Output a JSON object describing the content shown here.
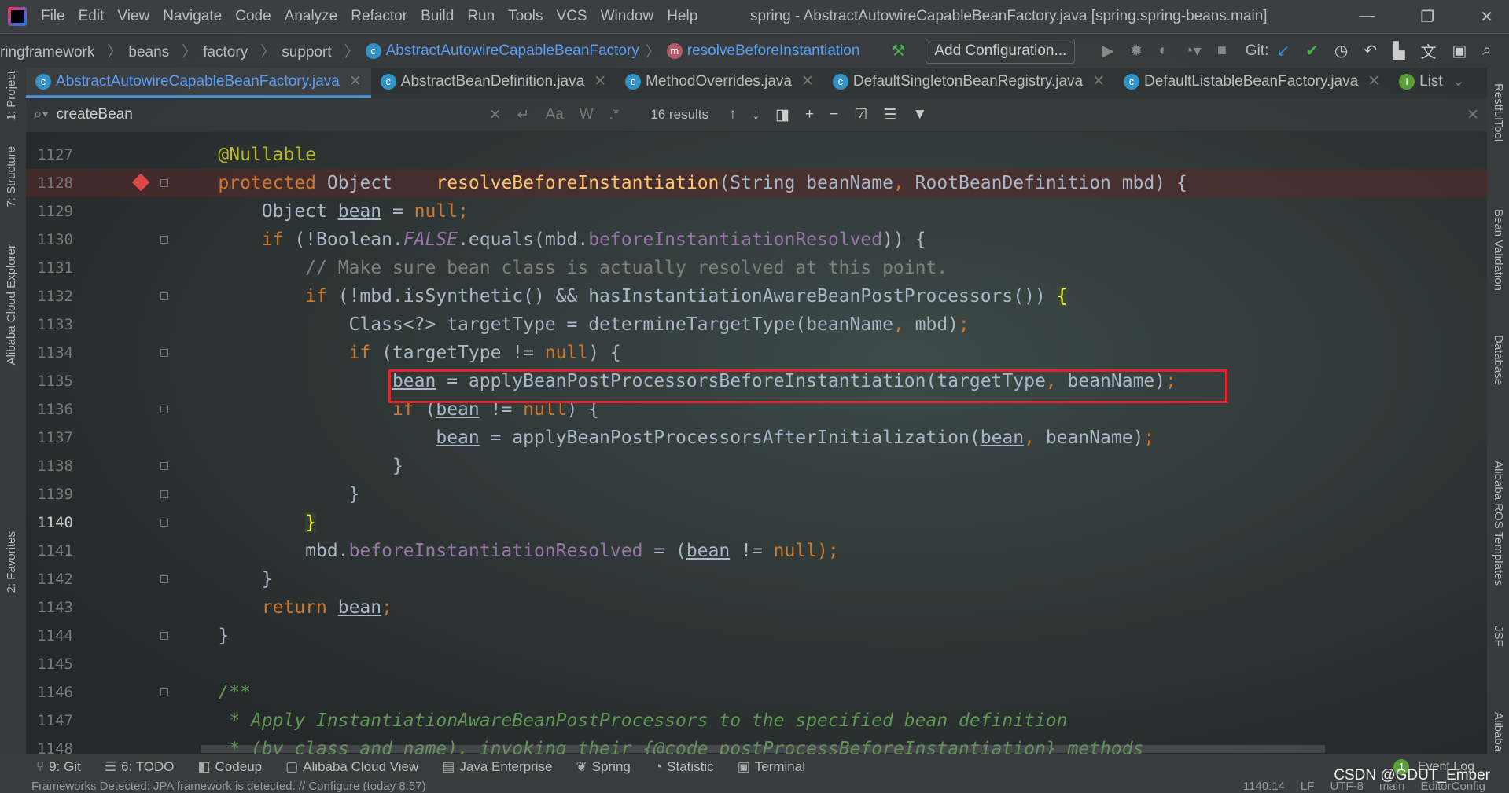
{
  "titlebar": {
    "menu": [
      "File",
      "Edit",
      "View",
      "Navigate",
      "Code",
      "Analyze",
      "Refactor",
      "Build",
      "Run",
      "Tools",
      "VCS",
      "Window",
      "Help"
    ],
    "title": "spring - AbstractAutowireCapableBeanFactory.java [spring.spring-beans.main]",
    "minimize": "—",
    "restore": "❐",
    "close": "✕"
  },
  "navbar": {
    "crumbs": [
      "ringframework",
      "beans",
      "factory",
      "support"
    ],
    "class_crumb": "AbstractAutowireCapableBeanFactory",
    "method_crumb": "resolveBeforeInstantiation",
    "add_config": "Add Configuration...",
    "git_label": "Git:"
  },
  "tabs": [
    {
      "label": "AbstractAutowireCapableBeanFactory.java",
      "icon": "c",
      "active": true
    },
    {
      "label": "AbstractBeanDefinition.java",
      "icon": "c"
    },
    {
      "label": "MethodOverrides.java",
      "icon": "c"
    },
    {
      "label": "DefaultSingletonBeanRegistry.java",
      "icon": "c"
    },
    {
      "label": "DefaultListableBeanFactory.java",
      "icon": "c"
    },
    {
      "label": "List",
      "icon": "I"
    }
  ],
  "search": {
    "value": "createBean",
    "results": "16 results",
    "match_case": "Aa",
    "words": "W",
    "regex": ".*"
  },
  "left_tools": [
    "1: Project",
    "7: Structure",
    "Alibaba Cloud Explorer",
    "2: Favorites"
  ],
  "right_tools": [
    "RestfulTool",
    "Bean Validation",
    "Database",
    "Alibaba ROS Templates",
    "JSF",
    "Alibaba"
  ],
  "editor": {
    "current_line": "1140",
    "lines": [
      {
        "n": "1127",
        "t": [
          [
            "    ",
            ""
          ],
          [
            "@Nullable",
            "an"
          ]
        ]
      },
      {
        "n": "1128",
        "bp": true,
        "t": [
          [
            "    ",
            ""
          ],
          [
            "protected ",
            "kw"
          ],
          [
            "Object    ",
            ""
          ],
          [
            "resolveBeforeInstantiation",
            "fn"
          ],
          [
            "(String beanName",
            ""
          ],
          [
            ", ",
            "kw"
          ],
          [
            "RootBeanDefinition mbd) {",
            ""
          ]
        ]
      },
      {
        "n": "1129",
        "t": [
          [
            "        Object ",
            ""
          ],
          [
            "bean",
            "ul"
          ],
          [
            " = ",
            ""
          ],
          [
            "null",
            "kw"
          ],
          [
            ";",
            "kw"
          ]
        ]
      },
      {
        "n": "1130",
        "t": [
          [
            "        ",
            ""
          ],
          [
            "if ",
            "kw"
          ],
          [
            "(!Boolean.",
            ""
          ],
          [
            "FALSE",
            "fd it"
          ],
          [
            ".equals(mbd.",
            ""
          ],
          [
            "beforeInstantiationResolved",
            "fd"
          ],
          [
            ")) {",
            ""
          ]
        ]
      },
      {
        "n": "1131",
        "t": [
          [
            "            ",
            ""
          ],
          [
            "// Make sure bean class is actually resolved at this point.",
            "cm"
          ]
        ]
      },
      {
        "n": "1132",
        "t": [
          [
            "            ",
            ""
          ],
          [
            "if ",
            "kw"
          ],
          [
            "(!mbd.isSynthetic() && hasInstantiationAwareBeanPostProcessors()) ",
            ""
          ],
          [
            "{",
            "br"
          ]
        ]
      },
      {
        "n": "1133",
        "t": [
          [
            "                Class<?> targetType = determineTargetType(beanName",
            ""
          ],
          [
            ", ",
            "kw"
          ],
          [
            "mbd)",
            ""
          ],
          [
            ";",
            "kw"
          ]
        ]
      },
      {
        "n": "1134",
        "t": [
          [
            "                ",
            ""
          ],
          [
            "if ",
            "kw"
          ],
          [
            "(targetType != ",
            ""
          ],
          [
            "null",
            "kw"
          ],
          [
            ") {",
            ""
          ]
        ]
      },
      {
        "n": "1135",
        "t": [
          [
            "                    ",
            ""
          ],
          [
            "bean",
            "ul"
          ],
          [
            " = applyBeanPostProcessorsBeforeInstantiation(targetType",
            ""
          ],
          [
            ", ",
            "kw"
          ],
          [
            "beanName)",
            ""
          ],
          [
            ";",
            "kw"
          ]
        ]
      },
      {
        "n": "1136",
        "t": [
          [
            "                    ",
            ""
          ],
          [
            "if ",
            "kw"
          ],
          [
            "(",
            ""
          ],
          [
            "bean",
            "ul"
          ],
          [
            " != ",
            ""
          ],
          [
            "null",
            "kw"
          ],
          [
            ") {",
            ""
          ]
        ]
      },
      {
        "n": "1137",
        "t": [
          [
            "                        ",
            ""
          ],
          [
            "bean",
            "ul"
          ],
          [
            " = applyBeanPostProcessorsAfterInitialization(",
            ""
          ],
          [
            "bean",
            "ul"
          ],
          [
            ", ",
            "kw"
          ],
          [
            "beanName)",
            ""
          ],
          [
            ";",
            "kw"
          ]
        ]
      },
      {
        "n": "1138",
        "t": [
          [
            "                    }",
            ""
          ]
        ]
      },
      {
        "n": "1139",
        "t": [
          [
            "                }",
            ""
          ]
        ]
      },
      {
        "n": "1140",
        "t": [
          [
            "            ",
            ""
          ],
          [
            "}",
            "br"
          ]
        ]
      },
      {
        "n": "1141",
        "t": [
          [
            "            mbd.",
            ""
          ],
          [
            "beforeInstantiationResolved",
            "fd"
          ],
          [
            " = (",
            ""
          ],
          [
            "bean",
            "ul"
          ],
          [
            " != ",
            ""
          ],
          [
            "null",
            "kw"
          ],
          [
            ");",
            "kw"
          ]
        ]
      },
      {
        "n": "1142",
        "t": [
          [
            "        }",
            ""
          ]
        ]
      },
      {
        "n": "1143",
        "t": [
          [
            "        ",
            ""
          ],
          [
            "return ",
            "kw"
          ],
          [
            "bean",
            "ul"
          ],
          [
            ";",
            "kw"
          ]
        ]
      },
      {
        "n": "1144",
        "t": [
          [
            "    }",
            ""
          ]
        ]
      },
      {
        "n": "1145",
        "t": [
          [
            "",
            ""
          ]
        ]
      },
      {
        "n": "1146",
        "t": [
          [
            "    ",
            ""
          ],
          [
            "/**",
            "dc"
          ]
        ]
      },
      {
        "n": "1147",
        "t": [
          [
            "     ",
            ""
          ],
          [
            "* Apply InstantiationAwareBeanPostProcessors to the specified bean definition",
            "dc"
          ]
        ]
      },
      {
        "n": "1148",
        "t": [
          [
            "     ",
            ""
          ],
          [
            "* (by class and name), invoking their {@code postProcessBeforeInstantiation} methods",
            "dc"
          ]
        ]
      }
    ]
  },
  "toolwindows": [
    {
      "icon": "⑂",
      "label": "9: Git"
    },
    {
      "icon": "☰",
      "label": "6: TODO"
    },
    {
      "icon": "◧",
      "label": "Codeup"
    },
    {
      "icon": "▢",
      "label": "Alibaba Cloud View"
    },
    {
      "icon": "▤",
      "label": "Java Enterprise"
    },
    {
      "icon": "❦",
      "label": "Spring"
    },
    {
      "icon": "◔",
      "label": "Statistic"
    },
    {
      "icon": "▣",
      "label": "Terminal"
    }
  ],
  "event_log": {
    "count": "1",
    "label": "Event Log"
  },
  "status": {
    "message": "Frameworks Detected: JPA framework is detected. // Configure (today 8:57)",
    "position": "1140:14",
    "line_sep": "LF",
    "encoding": "UTF-8",
    "branch": "main",
    "editorconfig": "EditorConfig"
  },
  "watermark": "CSDN @GDUT_Ember",
  "colors": {
    "keyword": "#cc7832",
    "annotation": "#bbb529",
    "method": "#ffc66d",
    "field": "#9876aa",
    "comment": "#808080",
    "doc": "#629755",
    "highlight_box": "#e8202a",
    "accent": "#4a88c7"
  }
}
